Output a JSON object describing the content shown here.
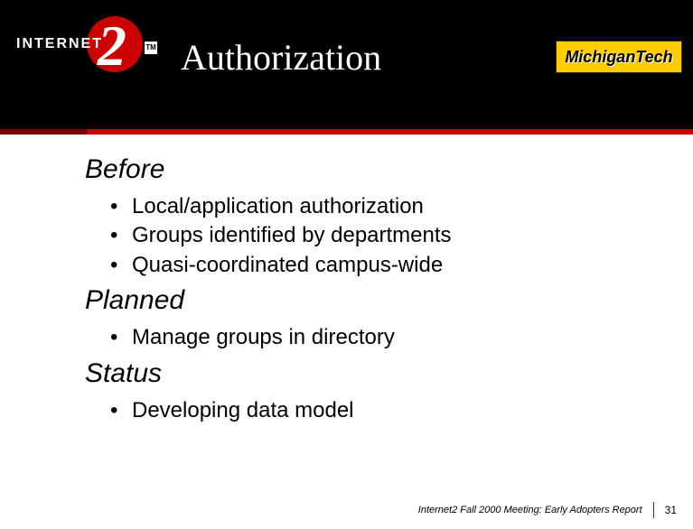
{
  "header": {
    "title": "Authorization",
    "logo_left": {
      "text": "INTERNET",
      "number": "2",
      "tm": "TM"
    },
    "logo_right": {
      "text": "MichiganTech"
    }
  },
  "sections": [
    {
      "heading": "Before",
      "bullets": [
        "Local/application authorization",
        "Groups identified by departments",
        "Quasi-coordinated campus-wide"
      ]
    },
    {
      "heading": "Planned",
      "bullets": [
        "Manage groups in directory"
      ]
    },
    {
      "heading": "Status",
      "bullets": [
        "Developing data model"
      ]
    }
  ],
  "footer": {
    "text": "Internet2 Fall 2000 Meeting: Early Adopters Report",
    "page": "31"
  }
}
